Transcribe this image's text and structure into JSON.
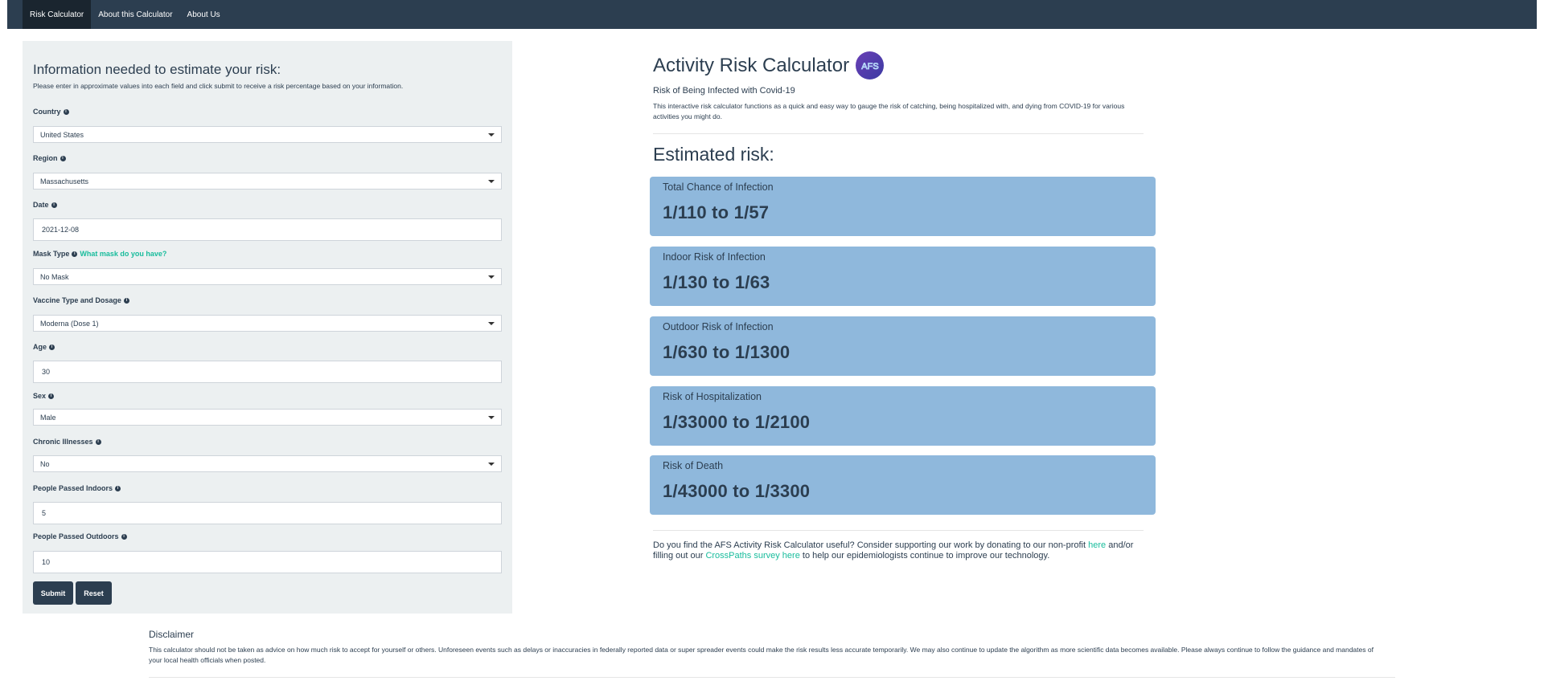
{
  "navbar": {
    "items": [
      {
        "label": "Risk Calculator",
        "active": true
      },
      {
        "label": "About this Calculator",
        "active": false
      },
      {
        "label": "About Us",
        "active": false
      }
    ]
  },
  "form": {
    "title": "Information needed to estimate your risk:",
    "subtitle": "Please enter in approximate values into each field and click submit to receive a risk percentage based on your information.",
    "country": {
      "label": "Country",
      "value": "United States"
    },
    "region": {
      "label": "Region",
      "value": "Massachusetts"
    },
    "date": {
      "label": "Date",
      "value": "2021-12-08"
    },
    "mask": {
      "label": "Mask Type",
      "help": "What mask do you have?",
      "value": "No Mask"
    },
    "vaccine": {
      "label": "Vaccine Type and Dosage",
      "value": "Moderna (Dose 1)"
    },
    "age": {
      "label": "Age",
      "value": "30"
    },
    "sex": {
      "label": "Sex",
      "value": "Male"
    },
    "chronic": {
      "label": "Chronic Illnesses",
      "value": "No"
    },
    "indoors": {
      "label": "People Passed Indoors",
      "value": "5"
    },
    "outdoors": {
      "label": "People Passed Outdoors",
      "value": "10"
    },
    "submit_label": "Submit",
    "reset_label": "Reset"
  },
  "header": {
    "title": "Activity Risk Calculator",
    "logo_text": "AFS",
    "subtitle": "Risk of Being Infected with Covid-19",
    "description": "This interactive risk calculator functions as a quick and easy way to gauge the risk of catching, being hospitalized with, and dying from COVID-19 for various activities you might do."
  },
  "results": {
    "title": "Estimated risk:",
    "cards": [
      {
        "label": "Total Chance of Infection",
        "value": "1/110 to 1/57"
      },
      {
        "label": "Indoor Risk of Infection",
        "value": "1/130 to 1/63"
      },
      {
        "label": "Outdoor Risk of Infection",
        "value": "1/630 to 1/1300"
      },
      {
        "label": "Risk of Hospitalization",
        "value": "1/33000 to 1/2100"
      },
      {
        "label": "Risk of Death",
        "value": "1/43000 to 1/3300"
      }
    ]
  },
  "support": {
    "text1": "Do you find the AFS Activity Risk Calculator useful? Consider supporting our work by donating to our non-profit ",
    "link1": "here",
    "text2": " and/or filling out our ",
    "link2": "CrossPaths survey here",
    "text3": " to help our epidemiologists continue to improve our technology."
  },
  "disclaimer": {
    "title": "Disclaimer",
    "text": "This calculator should not be taken as advice on how much risk to accept for yourself or others. Unforeseen events such as delays or inaccuracies in federally reported data or super spreader events could make the risk results less accurate temporarily. We may also continue to update the algorithm as more scientific data becomes available. Please always continue to follow the guidance and mandates of your local health officials when posted."
  },
  "colors": {
    "navbar": "#2c3e50",
    "accent": "#18bc9c",
    "card": "#8fb8dc",
    "panel": "#ecf0f1"
  }
}
